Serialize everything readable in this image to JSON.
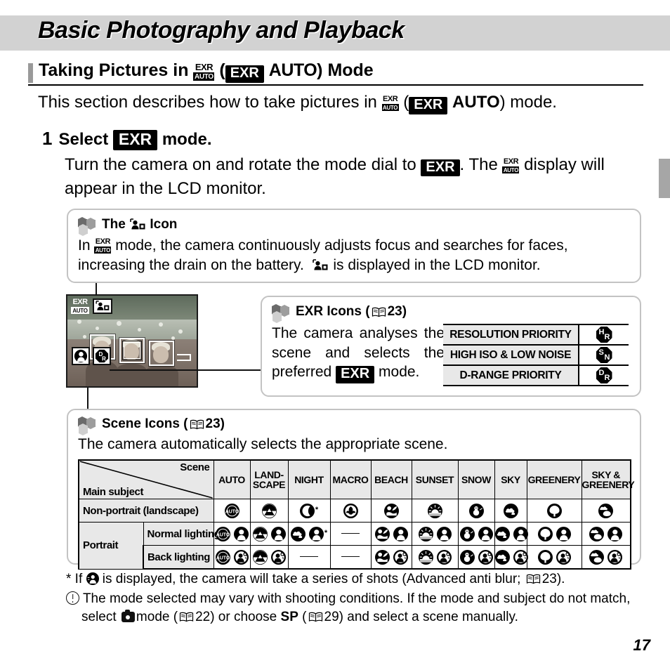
{
  "chapter": {
    "title": "Basic Photography and Playback"
  },
  "section": {
    "title_pre": "Taking Pictures in",
    "title_mid": "(",
    "title_exr": "EXR",
    "title_auto": "AUTO",
    "title_post": ") Mode"
  },
  "intro": {
    "text_pre": "This section describes how to take pictures in",
    "text_mid": "(",
    "text_exr": "EXR",
    "text_auto": "AUTO",
    "text_post": ") mode."
  },
  "step": {
    "number": "1",
    "head_pre": "Select",
    "head_post": "mode.",
    "body_pre": "Turn the camera on and rotate the mode dial to",
    "body_mid": ".  The",
    "body_post": "display will appear in the LCD monitor."
  },
  "icon_note": {
    "title_pre": "The",
    "title_post": "Icon",
    "body_pre": "In",
    "body_mid": "mode, the camera continuously adjusts focus and searches for faces, increasing the drain on the battery.",
    "body_post": "is displayed in the LCD monitor."
  },
  "exr_note": {
    "title": "EXR Icons (",
    "title_page": "23",
    "title_close": ")",
    "body_pre": "The camera analyses the scene and selects the preferred",
    "body_post": "mode.",
    "table": {
      "rows": [
        {
          "name": "RESOLUTION PRIORITY",
          "icon_left": "H",
          "icon_right": "R",
          "icon_name": "resolution-priority-icon"
        },
        {
          "name": "HIGH ISO & LOW NOISE",
          "icon_left": "S",
          "icon_right": "N",
          "icon_name": "high-iso-low-noise-icon"
        },
        {
          "name": "D-RANGE PRIORITY",
          "icon_left": "D",
          "icon_right": "R",
          "icon_name": "d-range-priority-icon"
        }
      ]
    }
  },
  "scene_note": {
    "title": "Scene Icons (",
    "title_page": "23",
    "title_close": ")",
    "body": "The camera automatically selects the appropriate scene.",
    "table": {
      "corner_scene": "Scene",
      "corner_main": "Main subject",
      "columns": [
        "AUTO",
        "LAND-SCAPE",
        "NIGHT",
        "MACRO",
        "BEACH",
        "SUNSET",
        "SNOW",
        "SKY",
        "GREENERY",
        "SKY & GREENERY"
      ],
      "row_labels": {
        "nonportrait": "Non-portrait (landscape)",
        "portrait": "Portrait",
        "normal": "Normal lighting",
        "back": "Back lighting"
      },
      "rows": [
        {
          "label": "Non-portrait (landscape)",
          "cells": [
            {
              "icons": [
                "auto"
              ]
            },
            {
              "icons": [
                "landscape"
              ]
            },
            {
              "icons": [
                "night"
              ],
              "star": true
            },
            {
              "icons": [
                "macro"
              ]
            },
            {
              "icons": [
                "beach"
              ]
            },
            {
              "icons": [
                "sunset"
              ]
            },
            {
              "icons": [
                "snow"
              ]
            },
            {
              "icons": [
                "sky"
              ]
            },
            {
              "icons": [
                "greenery"
              ]
            },
            {
              "icons": [
                "skygreenery"
              ]
            }
          ]
        },
        {
          "label": "Normal lighting",
          "cells": [
            {
              "icons": [
                "auto",
                "portrait"
              ]
            },
            {
              "icons": [
                "landscape",
                "portrait"
              ]
            },
            {
              "icons": [
                "night",
                "portrait"
              ],
              "star": true
            },
            {
              "icons": [],
              "dash": true
            },
            {
              "icons": [
                "beach",
                "portrait"
              ]
            },
            {
              "icons": [
                "sunset",
                "portrait"
              ]
            },
            {
              "icons": [
                "snow",
                "portrait"
              ]
            },
            {
              "icons": [
                "sky",
                "portrait"
              ]
            },
            {
              "icons": [
                "greenery",
                "portrait"
              ]
            },
            {
              "icons": [
                "skygreenery",
                "portrait"
              ]
            }
          ]
        },
        {
          "label": "Back lighting",
          "cells": [
            {
              "icons": [
                "auto",
                "backlight"
              ]
            },
            {
              "icons": [
                "landscape",
                "backlight"
              ]
            },
            {
              "icons": [],
              "dash": true
            },
            {
              "icons": [],
              "dash": true
            },
            {
              "icons": [
                "beach",
                "backlight"
              ]
            },
            {
              "icons": [
                "sunset",
                "backlight"
              ]
            },
            {
              "icons": [
                "snow",
                "backlight"
              ]
            },
            {
              "icons": [
                "sky",
                "backlight"
              ]
            },
            {
              "icons": [
                "greenery",
                "backlight"
              ]
            },
            {
              "icons": [
                "skygreenery",
                "backlight"
              ]
            }
          ]
        }
      ]
    }
  },
  "footnotes": {
    "star_pre": "* If",
    "star_mid": "is displayed, the camera will take a series of shots (Advanced anti blur;",
    "star_page": "23",
    "star_post": ").",
    "warn_pre": "The mode selected may vary with shooting conditions. If the mode and subject do not match, select",
    "warn_mid": "mode (",
    "warn_page1": "22",
    "warn_mid2": ") or choose",
    "warn_sp": "SP",
    "warn_mid3": "(",
    "warn_page2": "29",
    "warn_post": ") and select a scene manually."
  },
  "page": {
    "number": "17"
  },
  "colors": {
    "band": "#d2d2d2",
    "accent_bar": "#9a9a9a",
    "table_header": "#e8e8e8",
    "edge_tab": "#a6a6a6"
  }
}
